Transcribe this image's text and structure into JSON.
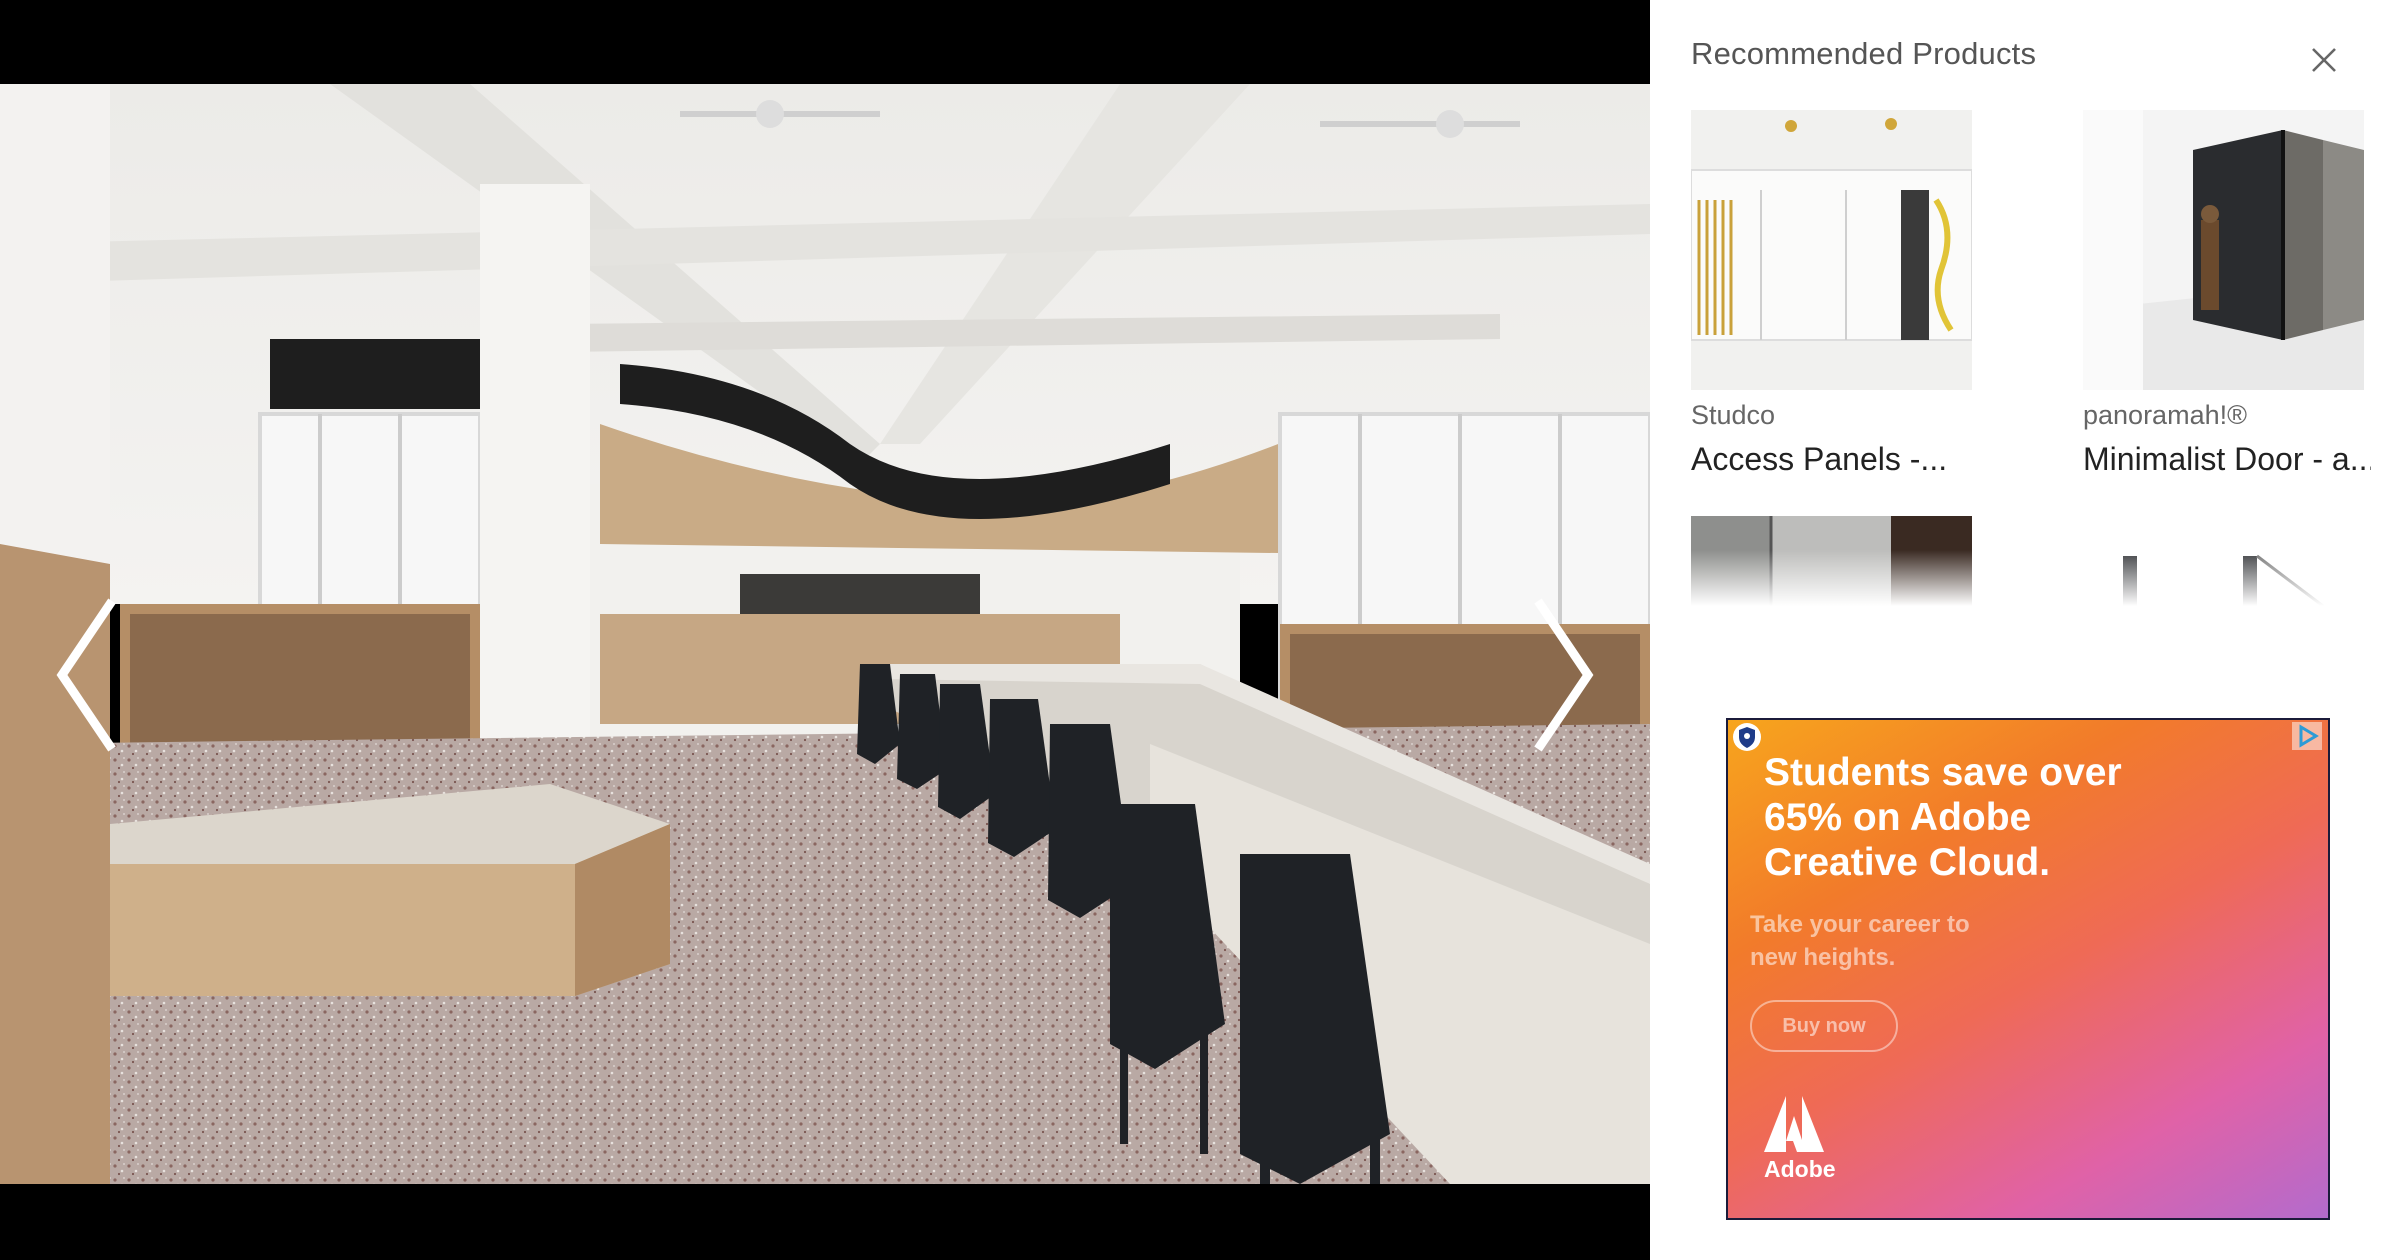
{
  "sidebar": {
    "title": "Recommended Products",
    "products": [
      {
        "brand": "Studco",
        "name": "Access Panels -..."
      },
      {
        "brand": "panoramah!®",
        "name": "Minimalist Door - a..."
      },
      {
        "brand": "",
        "name": ""
      },
      {
        "brand": "",
        "name": ""
      }
    ]
  },
  "ad": {
    "headline": "Students save over 65% on Adobe Creative Cloud.",
    "subtext": "Take your career to new heights.",
    "cta": "Buy now",
    "brand": "Adobe",
    "colors": {
      "gradient_start": "#f7a51d",
      "gradient_mid": "#ef6a56",
      "gradient_end": "#b36bcd"
    }
  },
  "icons": {
    "prev": "chevron-left-icon",
    "next": "chevron-right-icon",
    "close": "close-icon",
    "ad_shield": "shield-icon",
    "ad_choices": "adchoices-icon",
    "adobe_logo": "adobe-logo-icon"
  }
}
